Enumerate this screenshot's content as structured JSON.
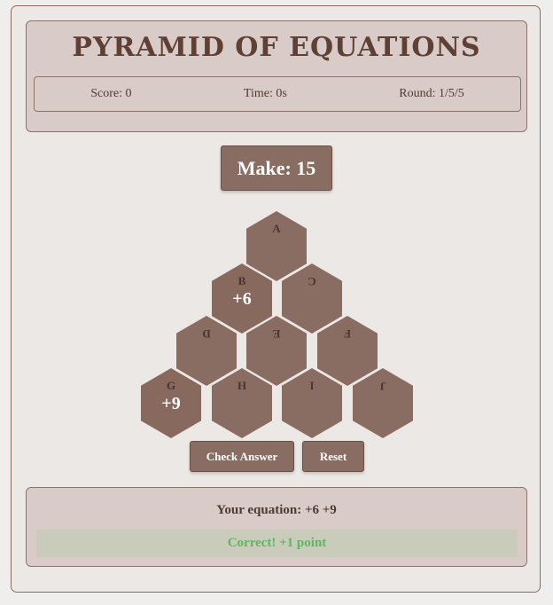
{
  "title": "PYRAMID OF EQUATIONS",
  "stats": {
    "score": "Score: 0",
    "time": "Time: 0s",
    "round": "Round: 1/5/5"
  },
  "target": "Make: 15",
  "hexes": [
    {
      "letter": "A",
      "value": ""
    },
    {
      "letter": "B",
      "value": "+6"
    },
    {
      "letter": "C",
      "value": ""
    },
    {
      "letter": "D",
      "value": ""
    },
    {
      "letter": "E",
      "value": ""
    },
    {
      "letter": "F",
      "value": ""
    },
    {
      "letter": "G",
      "value": "+9"
    },
    {
      "letter": "H",
      "value": ""
    },
    {
      "letter": "I",
      "value": ""
    },
    {
      "letter": "J",
      "value": ""
    }
  ],
  "buttons": {
    "check": "Check Answer",
    "reset": "Reset"
  },
  "result": {
    "equation": "Your equation: +6 +9",
    "feedback": "Correct! +1 point"
  },
  "colors": {
    "panel": "#d9ccc8",
    "tile": "#8a6d62",
    "success": "#5cb85c"
  }
}
